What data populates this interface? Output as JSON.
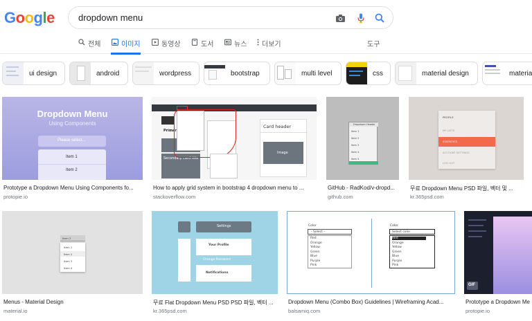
{
  "logo": {
    "letters": [
      {
        "ch": "G",
        "color": "#4285f4"
      },
      {
        "ch": "o",
        "color": "#ea4335"
      },
      {
        "ch": "o",
        "color": "#fbbc05"
      },
      {
        "ch": "g",
        "color": "#4285f4"
      },
      {
        "ch": "l",
        "color": "#34a853"
      },
      {
        "ch": "e",
        "color": "#ea4335"
      }
    ]
  },
  "search": {
    "value": "dropdown menu",
    "icons": [
      "camera-icon",
      "mic-icon",
      "search-icon"
    ]
  },
  "tabs": [
    {
      "label": "전체",
      "icon": "search-icon",
      "active": false
    },
    {
      "label": "이미지",
      "icon": "image-icon",
      "active": true
    },
    {
      "label": "동영상",
      "icon": "play-icon",
      "active": false
    },
    {
      "label": "도서",
      "icon": "book-icon",
      "active": false
    },
    {
      "label": "뉴스",
      "icon": "news-icon",
      "active": false
    },
    {
      "label": "더보기",
      "icon": "more-vert-icon",
      "active": false
    },
    {
      "label": "도구",
      "icon": "",
      "active": false
    }
  ],
  "chips": [
    {
      "label": "ui design"
    },
    {
      "label": "android"
    },
    {
      "label": "wordpress"
    },
    {
      "label": "bootstrap"
    },
    {
      "label": "multi level"
    },
    {
      "label": "css"
    },
    {
      "label": "material design"
    },
    {
      "label": "materia"
    }
  ],
  "results": [
    {
      "title": "Prototype a Dropdown Menu Using Components fo...",
      "source": "protopie.io",
      "image_text": {
        "heading": "Dropdown Menu",
        "sub": "Using Components",
        "placeholder": "Please select...",
        "item1": "Item 1",
        "item2": "Item 2"
      }
    },
    {
      "title": "How to apply grid system in bootstrap 4 dropdown menu to ...",
      "source": "stackoverflow.com",
      "image_text": {
        "card_header": "Card header",
        "image": "Image",
        "primary": "Primary",
        "secondary": "Secondary card title"
      }
    },
    {
      "title": "GitHub - RadKod/v-dropd...",
      "source": "github.com",
      "image_text": {
        "header": "Dropdown Header",
        "item1": "Item 1",
        "item2": "Item 2",
        "item3": "Item 3",
        "item4": "Item 4",
        "item5": "Item 5"
      }
    },
    {
      "title": "무료 Dropdown Menu PSD 파일, 벡터 및 ...",
      "source": "kr.365psd.com",
      "image_text": {
        "profile": "PROFILE",
        "lists": "MY LISTS",
        "statistics": "STATISTICS",
        "settings": "ACCOUNT SETTINGS",
        "logout": "LOG OUT"
      }
    },
    {
      "title": "Menus - Material Design",
      "source": "material.io",
      "image_text": {
        "selected": "Item 2",
        "item1": "Item 1",
        "item2": "Item 2",
        "item3": "Item 3",
        "item4": "Item 4"
      }
    },
    {
      "title": "무료 Flat Dropdown Menu PSD PSD 파일, 벡터 ...",
      "source": "kr.365psd.com",
      "image_text": {
        "settings": "Settings",
        "profile": "Your Profile",
        "password": "Change Password",
        "notifications": "Notifications"
      }
    },
    {
      "title": "Dropdown Menu (Combo Box) Guidelines | Wireframing Acad...",
      "source": "balsamiq.com",
      "image_text": {
        "label_left": "Color",
        "select_left": "- Select -",
        "label_right": "Color",
        "select_right": "Select color",
        "options": [
          "Red",
          "Orange",
          "Yellow",
          "Green",
          "Blue",
          "Purple",
          "Pink"
        ]
      }
    },
    {
      "title": "Prototype a Dropdown Me",
      "source": "protopie.io",
      "image_text": {
        "badge": "GIF"
      }
    }
  ],
  "colors": {
    "accent": "#1a73e8",
    "muted": "#5f6368"
  }
}
